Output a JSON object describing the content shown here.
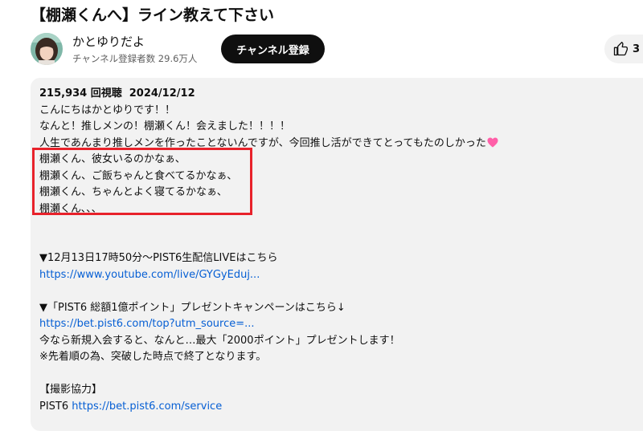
{
  "video": {
    "title": "【棚瀬くんへ】ライン教えて下さい"
  },
  "channel": {
    "name": "かとゆりだよ",
    "subscribers": "チャンネル登録者数 29.6万人",
    "subscribe_label": "チャンネル登録"
  },
  "actions": {
    "like_count": "3",
    "like_icon": "thumbs-up-icon"
  },
  "description": {
    "views": "215,934 回視聴",
    "date": "2024/12/12",
    "lines": {
      "l1": "こんにちはかとゆりです！！",
      "l2": "なんと！推しメンの！棚瀬くん！会えました！！！！",
      "l3": "人生であんまり推しメンを作ったことないんですが、今回推し活ができてとってもたのしかった",
      "l4": "棚瀬くん、彼女いるのかなぁ、",
      "l5": "棚瀬くん、ご飯ちゃんと食べてるかなぁ、",
      "l6": "棚瀬くん、ちゃんとよく寝てるかなぁ、",
      "l7": "棚瀬くん､､､",
      "live_intro": "▼12月13日17時50分〜PIST6生配信LIVEはこちら",
      "live_link": "https://www.youtube.com/live/GYGyEduj...",
      "campaign_intro": "▼「PIST6 総額1億ポイント」プレゼントキャンペーンはこちら↓",
      "campaign_link": "https://bet.pist6.com/top?utm_source=...",
      "campaign_body": "今なら新規入会すると、なんと…最大「2000ポイント」プレゼントします！",
      "campaign_note": "※先着順の為、突破した時点で終了となります。",
      "credit_heading": "【撮影協力】",
      "credit_name": "PIST6",
      "credit_link": "https://bet.pist6.com/service"
    },
    "emoji": "pink-heart-icon"
  },
  "highlight_color": "#e8222b",
  "colors": {
    "link": "#065fd4",
    "subscribe_bg": "#0f0f0f",
    "panel_bg": "#f2f2f2"
  }
}
